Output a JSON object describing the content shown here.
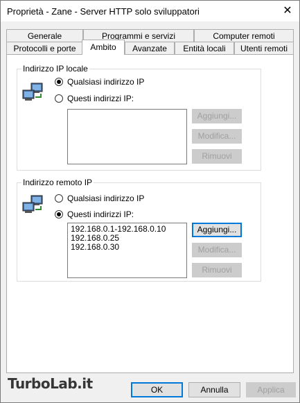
{
  "window": {
    "title": "Proprietà - Zane - Server HTTP solo sviluppatori",
    "close_glyph": "✕"
  },
  "tabs": {
    "row1": [
      "Generale",
      "Programmi e servizi",
      "Computer remoti"
    ],
    "row2": [
      "Protocolli e porte",
      "Ambito",
      "Avanzate",
      "Entità locali",
      "Utenti remoti"
    ],
    "active": "Ambito"
  },
  "local": {
    "label": "Indirizzo IP locale",
    "opt_any": "Qualsiasi indirizzo IP",
    "opt_these": "Questi indirizzi IP:",
    "selected": "any",
    "addresses": [],
    "add": "Aggiungi...",
    "edit": "Modifica...",
    "remove": "Rimuovi"
  },
  "remote": {
    "label": "Indirizzo remoto IP",
    "opt_any": "Qualsiasi indirizzo IP",
    "opt_these": "Questi indirizzi IP:",
    "selected": "these",
    "addresses": [
      "192.168.0.1-192.168.0.10",
      "192.168.0.25",
      "192.168.0.30"
    ],
    "add": "Aggiungi...",
    "edit": "Modifica...",
    "remove": "Rimuovi"
  },
  "footer": {
    "ok": "OK",
    "cancel": "Annulla",
    "apply": "Applica"
  },
  "watermark": "TurboLab.it",
  "icons": [
    "network-computers-icon",
    "network-computers-icon",
    "close-icon"
  ]
}
